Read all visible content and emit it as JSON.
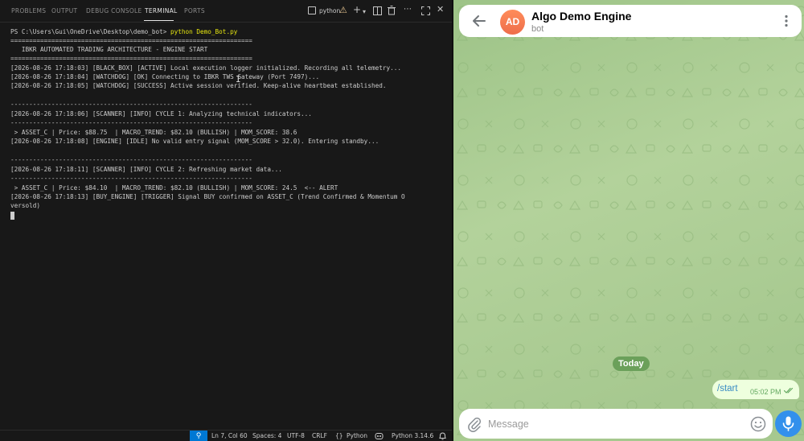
{
  "vscode": {
    "panel_tabs": [
      {
        "label": "PROBLEMS",
        "active": false
      },
      {
        "label": "OUTPUT",
        "active": false
      },
      {
        "label": "DEBUG CONSOLE",
        "active": false
      },
      {
        "label": "TERMINAL",
        "active": true
      },
      {
        "label": "PORTS",
        "active": false
      }
    ],
    "terminal_name": "python",
    "toolbar_icons": [
      "terminal-icon",
      "warning-icon",
      "add-terminal-icon",
      "chevron-down-icon",
      "split-terminal-icon",
      "trash-icon",
      "more-icon",
      "maximize-icon",
      "close-icon"
    ],
    "terminal_lines": [
      {
        "prompt": "PS C:\\Users\\Gui\\OneDrive\\Desktop\\demo_bot> ",
        "command": "python Demo_Bot.py"
      },
      {
        "text": "================================================================="
      },
      {
        "text": "   IBKR AUTOMATED TRADING ARCHITECTURE - ENGINE START"
      },
      {
        "text": "================================================================="
      },
      {
        "text": "[2026-08-26 17:18:03] [BLACK_BOX] [ACTIVE] Local execution logger initialized. Recording all telemetry..."
      },
      {
        "text": "[2026-08-26 17:18:04] [WATCHDOG] [OK] Connecting to IBKR TWS Gateway (Port 7497)..."
      },
      {
        "text": "[2026-08-26 17:18:05] [WATCHDOG] [SUCCESS] Active session verified. Keep-alive heartbeat established."
      },
      {
        "text": ""
      },
      {
        "text": "-----------------------------------------------------------------"
      },
      {
        "text": "[2026-08-26 17:18:06] [SCANNER] [INFO] CYCLE 1: Analyzing technical indicators..."
      },
      {
        "text": "-----------------------------------------------------------------"
      },
      {
        "text": " > ASSET_C | Price: $88.75  | MACRO_TREND: $82.10 (BULLISH) | MOM_SCORE: 38.6"
      },
      {
        "text": "[2026-08-26 17:18:08] [ENGINE] [IDLE] No valid entry signal (MOM_SCORE > 32.0). Entering standby..."
      },
      {
        "text": ""
      },
      {
        "text": "-----------------------------------------------------------------"
      },
      {
        "text": "[2026-08-26 17:18:11] [SCANNER] [INFO] CYCLE 2: Refreshing market data..."
      },
      {
        "text": "-----------------------------------------------------------------"
      },
      {
        "text": " > ASSET_C | Price: $84.10  | MACRO_TREND: $82.10 (BULLISH) | MOM_SCORE: 24.5  <-- ALERT"
      },
      {
        "text": "[2026-08-26 17:18:13] [BUY_ENGINE] [TRIGGER] Signal BUY confirmed on ASSET_C (Trend Confirmed & Momentum O"
      },
      {
        "text": "versold)"
      }
    ],
    "status_bar": {
      "zoom_icon": "zoom-icon",
      "position": "Ln 7, Col 60",
      "spaces": "Spaces: 4",
      "encoding": "UTF-8",
      "eol": "CRLF",
      "language": "Python",
      "language_icon": "braces-icon",
      "python_version": "Python 3.14.6",
      "copilot_icon": "copilot-icon",
      "bell_icon": "bell-icon"
    }
  },
  "telegram": {
    "header": {
      "avatar_initials": "AD",
      "title": "Algo Demo Engine",
      "subtitle": "bot",
      "back_icon": "arrow-left-icon",
      "menu_icon": "more-vertical-icon"
    },
    "date_separator": "Today",
    "messages": [
      {
        "text": "/start",
        "time": "05:02 PM",
        "outgoing": true,
        "read": true
      }
    ],
    "composer": {
      "placeholder": "Message",
      "attach_icon": "paperclip-icon",
      "emoji_icon": "smile-icon",
      "mic_icon": "microphone-icon"
    },
    "colors": {
      "background": "#a8c98f",
      "avatar": "#f07a52",
      "accent": "#3390ec",
      "date_pill": "#6ba05a",
      "outgoing_bubble": "#eeffde"
    }
  },
  "colors": {
    "terminal_bg": "#181818",
    "terminal_text": "#cccccc",
    "prompt_command": "#e5e510",
    "status_accent": "#0078d4"
  }
}
